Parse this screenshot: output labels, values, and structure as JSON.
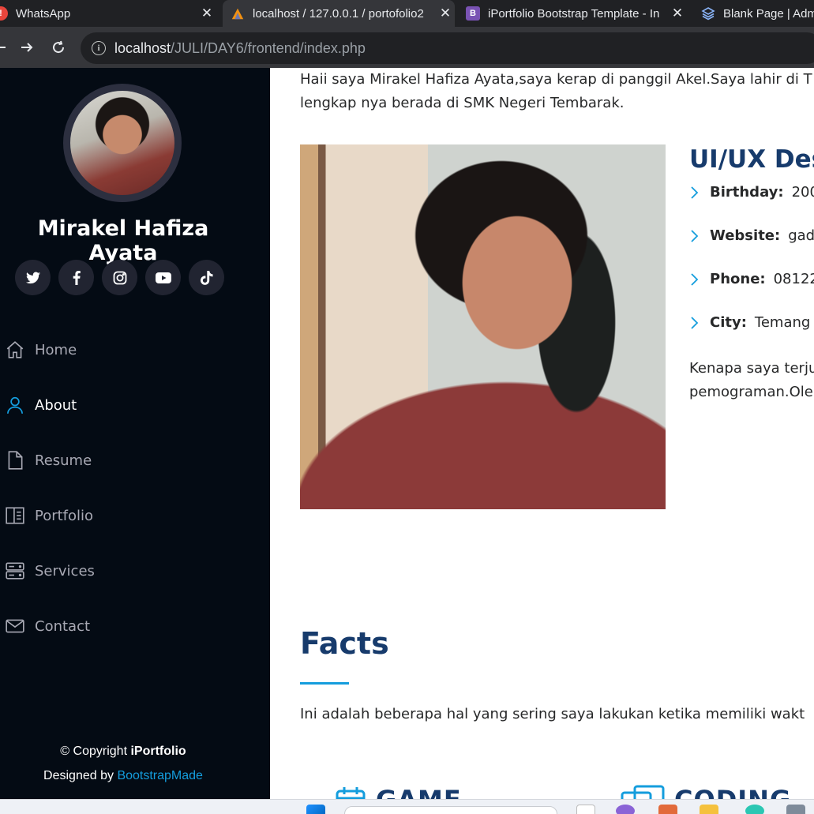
{
  "browser": {
    "tabs": [
      {
        "title": "WhatsApp",
        "favicon": "whatsapp-icon",
        "active": false
      },
      {
        "title": "localhost / 127.0.0.1 / portofolio2",
        "favicon": "phpmyadmin-icon",
        "active": true
      },
      {
        "title": "iPortfolio Bootstrap Template - In",
        "favicon": "bootstrap-icon",
        "active": false
      },
      {
        "title": "Blank Page | Adm",
        "favicon": "layers-icon",
        "active": false
      }
    ],
    "url_host": "localhost",
    "url_path": "/JULI/DAY6/frontend/index.php",
    "colors": {
      "tabbar": "#202124",
      "toolbar": "#35363a"
    }
  },
  "sidebar": {
    "name": "Mirakel Hafiza Ayata",
    "socials": [
      "twitter-icon",
      "facebook-icon",
      "instagram-icon",
      "youtube-icon",
      "tiktok-icon"
    ],
    "nav": [
      {
        "label": "Home",
        "icon": "house-icon",
        "active": false
      },
      {
        "label": "About",
        "icon": "person-icon",
        "active": true
      },
      {
        "label": "Resume",
        "icon": "file-icon",
        "active": false
      },
      {
        "label": "Portfolio",
        "icon": "book-half-icon",
        "active": false
      },
      {
        "label": "Services",
        "icon": "server-icon",
        "active": false
      },
      {
        "label": "Contact",
        "icon": "envelope-icon",
        "active": false
      }
    ],
    "copyright_prefix": "© Copyright",
    "copyright_brand": "iPortfolio",
    "designed_by_prefix": "Designed by",
    "designed_by_link": "BootstrapMade",
    "colors": {
      "background": "#040b14",
      "accent": "#149ddd"
    }
  },
  "about": {
    "intro_line1": "Haii saya Mirakel Hafiza Ayata,saya kerap di panggil Akel.Saya lahir di T",
    "intro_line2": "lengkap nya berada di SMK Negeri Tembarak.",
    "title": "UI/UX Des",
    "details": [
      {
        "label": "Birthday:",
        "value": "200"
      },
      {
        "label": "Website:",
        "value": "gad"
      },
      {
        "label": "Phone:",
        "value": "08122"
      },
      {
        "label": "City:",
        "value": "Temang"
      }
    ],
    "why_line1": "Kenapa saya terju",
    "why_line2": "pemograman.Ole"
  },
  "facts": {
    "title": "Facts",
    "description": "Ini adalah beberapa hal yang sering saya lakukan ketika memiliki wakt",
    "items": [
      {
        "label": "GAME",
        "icon": "calendar-icon"
      },
      {
        "label": "CODING",
        "icon": "window-icon"
      }
    ],
    "colors": {
      "heading": "#173b6c",
      "accent": "#149ddd"
    }
  }
}
